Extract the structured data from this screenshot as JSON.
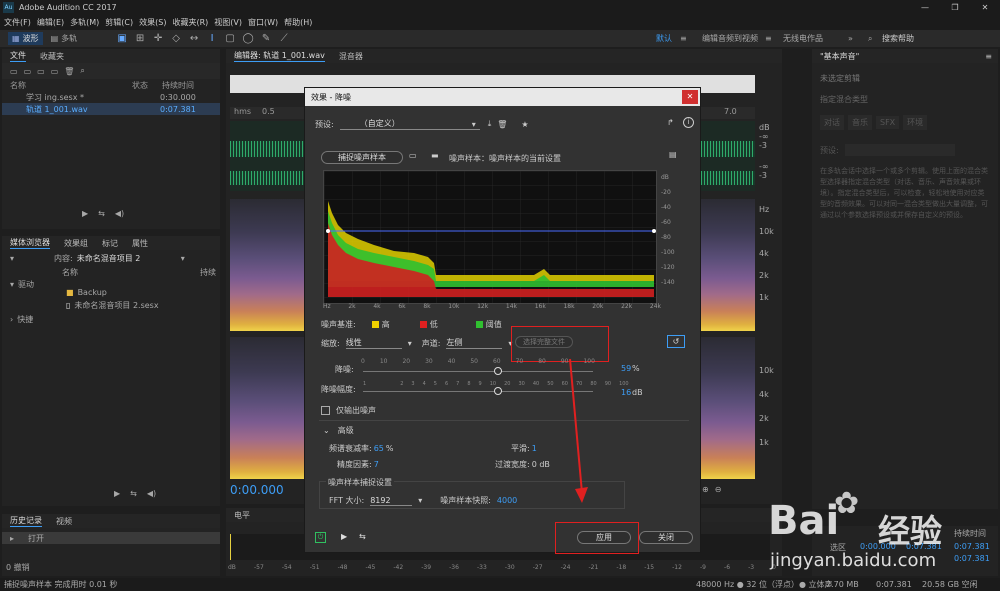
{
  "app": {
    "title": "Adobe Audition CC 2017",
    "logo": "Au"
  },
  "menu": [
    "文件(F)",
    "编辑(E)",
    "多轨(M)",
    "剪辑(C)",
    "效果(S)",
    "收藏夹(R)",
    "视图(V)",
    "窗口(W)",
    "帮助(H)"
  ],
  "toolbar": {
    "waveform": "波形",
    "multitrack": "多轨",
    "workspace": "默认",
    "edit_video": "编辑音频到视频",
    "radio": "无线电作品",
    "search_placeholder": "搜索帮助"
  },
  "files_panel": {
    "tabs": [
      "文件",
      "收藏夹"
    ],
    "columns": [
      "名称",
      "状态",
      "持续时间"
    ],
    "rows": [
      {
        "name": "学习 ing.sesx *",
        "duration": "0:30.000"
      },
      {
        "name": "轨道 1_001.wav",
        "duration": "0:07.381"
      }
    ]
  },
  "media_panel": {
    "tabs": [
      "媒体浏览器",
      "效果组",
      "标记",
      "属性"
    ],
    "content_label": "内容:",
    "content_value": "未命名混音项目 2",
    "name_col": "名称",
    "dur_col": "持续",
    "tree": [
      "驱动",
      "快捷"
    ],
    "items": [
      "Backup",
      "未命名混音项目 2.sesx"
    ]
  },
  "history_panel": {
    "tabs": [
      "历史记录",
      "视频"
    ],
    "item": "打开",
    "undo": "0 撤销"
  },
  "editor": {
    "tabs": [
      "编辑器: 轨道 1_001.wav",
      "混音器"
    ],
    "ruler": [
      "hms",
      "0.5",
      "7.0"
    ],
    "db_labels": [
      "dB",
      "-∞",
      "-3",
      "-∞",
      "-3"
    ],
    "hz_labels": [
      "Hz",
      "10k",
      "4k",
      "2k",
      "1k",
      "10k",
      "4k",
      "2k",
      "1k"
    ],
    "time": "0:00.000"
  },
  "level_panel": {
    "title": "电平",
    "scale": [
      "dB",
      "-57",
      "-54",
      "-51",
      "-48",
      "-45",
      "-42",
      "-39",
      "-36",
      "-33",
      "-30",
      "-27",
      "-24",
      "-21",
      "-18",
      "-15",
      "-12",
      "-9",
      "-6",
      "-3",
      "0"
    ]
  },
  "selection_panel": {
    "label": "选区",
    "start": "0:00.000",
    "end": "0:07.381",
    "duration_label": "持续时间",
    "dur1": "0:07.381",
    "dur2": "0:07.381"
  },
  "essential_sound": {
    "title": "\"基本声音\"",
    "no_selection": "未选定剪辑",
    "assign_label": "指定混合类型",
    "types": [
      "对话",
      "音乐",
      "SFX",
      "环境"
    ],
    "preset_label": "预设:",
    "description": "在多轨会话中选择一个或多个剪辑。使用上面的混合类型选择器指定混合类型（对话、音乐、声音效果或环境）。指定混合类型后，可以检查，轻松地使用对应类型的音频效果。可以对同一混合类型做出大量调整，可通过以个参数选择预设或并保存自定义的预设。"
  },
  "status": {
    "left": "捕捉噪声样本 完成用时 0.01 秒",
    "sample": "48000 Hz ● 32 位（浮点）● 立体声",
    "size": "2.70 MB",
    "time": "0:07.381",
    "free": "20.58 GB 空闲"
  },
  "dialog": {
    "title": "效果 - 降噪",
    "preset_label": "预设:",
    "preset_value": "（自定义）",
    "capture_btn": "捕捉噪声样本",
    "noise_print_text": "噪声样本：噪声样本的当前设置",
    "graph_db_labels": [
      "dB",
      "-20",
      "-40",
      "-60",
      "-80",
      "-100",
      "-120",
      "-140"
    ],
    "graph_hz_labels": [
      "Hz",
      "2k",
      "4k",
      "6k",
      "8k",
      "10k",
      "12k",
      "14k",
      "16k",
      "18k",
      "20k",
      "22k",
      "24k"
    ],
    "legend_label": "噪声基准:",
    "legend": [
      {
        "name": "高",
        "color": "#f0d000"
      },
      {
        "name": "低",
        "color": "#e02020"
      },
      {
        "name": "阈值",
        "color": "#30c030"
      }
    ],
    "scale_label": "缩放:",
    "scale_value": "线性",
    "channel_label": "声道:",
    "channel_value": "左侧",
    "select_all_btn": "选择完整文件",
    "reduction_label": "降噪:",
    "reduction_value": "59",
    "reduction_unit": "%",
    "reduction_ticks": [
      "0",
      "10",
      "20",
      "30",
      "40",
      "50",
      "60",
      "70",
      "80",
      "90",
      "100"
    ],
    "reduce_by_label": "降噪幅度:",
    "reduce_by_value": "16",
    "reduce_by_unit": "dB",
    "reduce_by_ticks": [
      "1",
      "2",
      "3",
      "4",
      "5",
      "6",
      "7",
      "8",
      "9",
      "10",
      "20",
      "30",
      "40",
      "50",
      "60",
      "70",
      "80",
      "90",
      "100"
    ],
    "output_noise_only": "仅输出噪声",
    "advanced_label": "高级",
    "spectral_decay_label": "频谱衰减率:",
    "spectral_decay_value": "65",
    "spectral_decay_unit": "%",
    "smoothing_label": "平滑:",
    "smoothing_value": "1",
    "precision_label": "精度因素:",
    "precision_value": "7",
    "transition_label": "过渡宽度:",
    "transition_value": "0 dB",
    "capture_settings_label": "噪声样本捕捉设置",
    "fft_label": "FFT 大小:",
    "fft_value": "8192",
    "snapshots_label": "噪声样本快照:",
    "snapshots_value": "4000",
    "apply_btn": "应用",
    "close_btn": "关闭"
  },
  "watermark": {
    "brand": "Bai",
    "brand2": "经验",
    "url": "jingyan.baidu.com"
  }
}
